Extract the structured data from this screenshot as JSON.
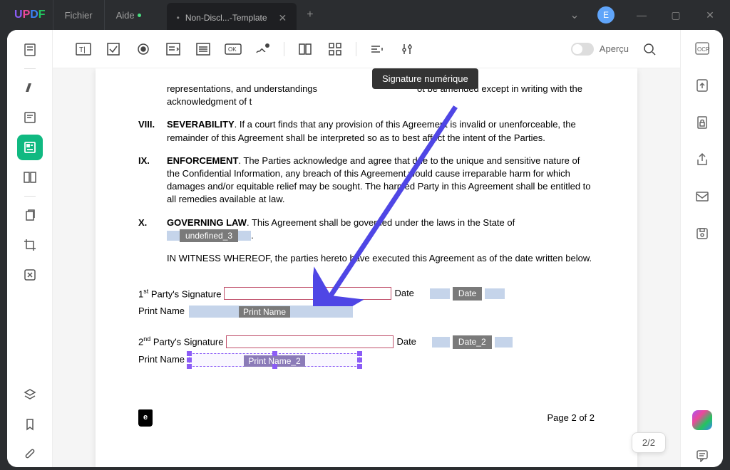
{
  "app": {
    "name": "UPDF"
  },
  "menu": {
    "file": "Fichier",
    "help": "Aide"
  },
  "tab": {
    "title": "Non-Discl...-Template"
  },
  "avatar": {
    "initial": "E"
  },
  "toolbar": {
    "tooltip": "Signature numérique",
    "preview": "Aperçu"
  },
  "doc": {
    "para_top": "representations, and understandings",
    "para_top2": "ot be amended except in writing with the acknowledgment of t",
    "sec8": {
      "num": "VIII.",
      "title": "SEVERABILITY",
      "text": ". If a court finds that any provision of this Agreement is invalid or unenforceable, the remainder of this Agreement shall be interpreted so as to best affect the intent of the Parties."
    },
    "sec9": {
      "num": "IX.",
      "title": "ENFORCEMENT",
      "text1": ". The Parties acknowledge and agree that due to the unique and sensitive nature of the Confidential Information, any breach of this Agreement would cause irreparable harm for which damages and/or equitable relief may be sought. The harmed Party in this Agreement shall be entitled to all remedies available at law."
    },
    "sec10": {
      "num": "X.",
      "title": "GOVERNING LAW",
      "text": ". This Agreement shall be governed under the laws in the State of",
      "field": "undefined_3",
      "dot": "."
    },
    "witness": "IN WITNESS WHEREOF, the parties hereto have executed this Agreement as of the date written below.",
    "sig1": {
      "label1": "1",
      "sup": "st",
      "label2": " Party's Signature",
      "date": "Date",
      "datefield": "Date",
      "print": "Print Name",
      "printfield": "Print Name"
    },
    "sig2": {
      "label1": "2",
      "sup": "nd",
      "label2": " Party's Signature",
      "date": "Date",
      "datefield": "Date_2",
      "print": "Print Name",
      "printfield": "Print Name_2"
    },
    "pagenum": "Page 2 of 2"
  },
  "pageind": "2/2"
}
